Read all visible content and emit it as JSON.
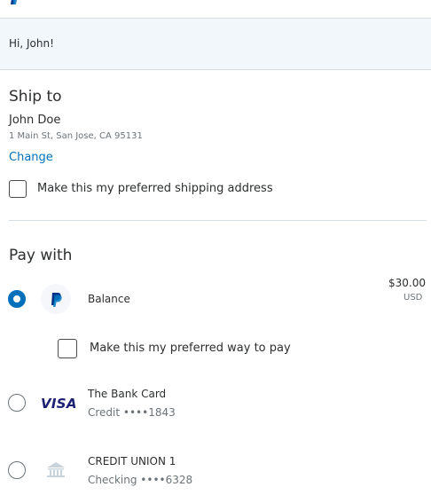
{
  "header": {
    "greeting": "Hi, John!"
  },
  "ship_to": {
    "heading": "Ship to",
    "name": "John Doe",
    "address": "1 Main St, San Jose, CA 95131",
    "change_label": "Change",
    "preferred_label": "Make this my preferred shipping address",
    "preferred_checked": false
  },
  "pay_with": {
    "heading": "Pay with",
    "preferred_label": "Make this my preferred way to pay",
    "preferred_checked": false,
    "options": [
      {
        "icon": "paypal-icon",
        "label": "Balance",
        "amount": "$30.00",
        "currency": "USD",
        "selected": true
      },
      {
        "icon": "visa-icon",
        "icon_text": "VISA",
        "label": "The Bank Card",
        "sub": "Credit ••••1843",
        "selected": false
      },
      {
        "icon": "bank-icon",
        "label": "CREDIT UNION 1",
        "sub": "Checking ••••6328",
        "selected": false
      }
    ]
  },
  "colors": {
    "accent": "#0070ba",
    "greeting_bg": "#f2f7fb",
    "text": "#2c2e2f",
    "muted": "#6c7378",
    "visa": "#1a1f71"
  }
}
